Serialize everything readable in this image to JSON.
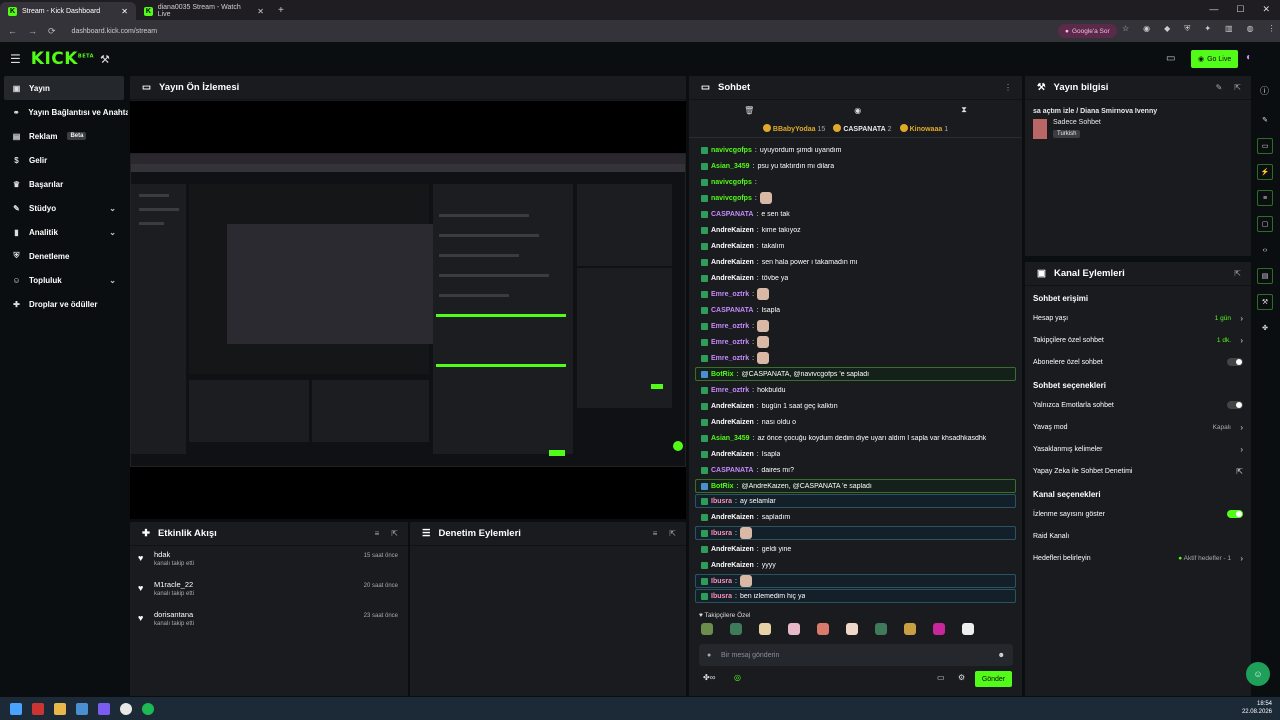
{
  "browser": {
    "tabs": [
      {
        "label": "Stream - Kick Dashboard",
        "active": true
      },
      {
        "label": "diana0035 Stream - Watch Live",
        "active": false
      }
    ],
    "url": "dashboard.kick.com/stream",
    "google_pill": "Google'a Sor"
  },
  "topbar": {
    "logo": "KICK",
    "logo_sup": "BETA",
    "go_live": "Go Live"
  },
  "sidebar": {
    "items": [
      {
        "label": "Yayın",
        "icon": "stream-icon",
        "active": true
      },
      {
        "label": "Yayın Bağlantısı ve Anahtarı",
        "icon": "link-icon"
      },
      {
        "label": "Reklam",
        "icon": "ad-icon",
        "badge": "Beta"
      },
      {
        "label": "Gelir",
        "icon": "dollar-icon"
      },
      {
        "label": "Başarılar",
        "icon": "trophy-icon"
      },
      {
        "label": "Stüdyo",
        "icon": "studio-icon",
        "chevron": true
      },
      {
        "label": "Analitik",
        "icon": "chart-icon",
        "chevron": true
      },
      {
        "label": "Denetleme",
        "icon": "shield-icon"
      },
      {
        "label": "Topluluk",
        "icon": "community-icon",
        "chevron": true
      },
      {
        "label": "Droplar ve ödüller",
        "icon": "gift-icon"
      }
    ]
  },
  "preview": {
    "title": "Yayın Ön İzlemesi"
  },
  "activity": {
    "title": "Etkinlik Akışı",
    "items": [
      {
        "name": "hdak",
        "action": "kanalı takip etti",
        "time": "15 saat önce"
      },
      {
        "name": "M1racle_22",
        "action": "kanalı takip etti",
        "time": "20 saat önce"
      },
      {
        "name": "dorisantana",
        "action": "kanalı takip etti",
        "time": "23 saat önce"
      }
    ]
  },
  "moderation": {
    "title": "Denetim Eylemleri"
  },
  "chat": {
    "title": "Sohbet",
    "top": [
      {
        "name": "BBabyYodaa",
        "count": "15",
        "color": "#e0a92a"
      },
      {
        "name": "CASPANATA",
        "count": "2",
        "color": "#ffffff"
      },
      {
        "name": "Kinowaaa",
        "count": "1",
        "color": "#e0a92a"
      }
    ],
    "messages": [
      {
        "user": "navivcgofps",
        "text": "uyuyordum şimdi uyandım",
        "color": "#53fc18",
        "type": ""
      },
      {
        "user": "Asian_3459",
        "text": "psu yu taktırdın mı dilara",
        "color": "#53fc18",
        "type": ""
      },
      {
        "user": "navivcgofps",
        "text": "",
        "color": "#53fc18",
        "type": ""
      },
      {
        "user": "navivcgofps",
        "text": "",
        "color": "#53fc18",
        "type": "emote"
      },
      {
        "user": "CASPANATA",
        "text": "e sen tak",
        "color": "#c58bff",
        "type": ""
      },
      {
        "user": "AndreKaizen",
        "text": "kime takıyoz",
        "color": "#ffffff",
        "type": ""
      },
      {
        "user": "AndreKaizen",
        "text": "takalım",
        "color": "#ffffff",
        "type": ""
      },
      {
        "user": "AndreKaizen",
        "text": "sen hala power ı takamadın mı",
        "color": "#ffffff",
        "type": ""
      },
      {
        "user": "AndreKaizen",
        "text": "tövbe ya",
        "color": "#ffffff",
        "type": ""
      },
      {
        "user": "Emre_oztrk",
        "text": "",
        "color": "#c58bff",
        "type": "emote"
      },
      {
        "user": "CASPANATA",
        "text": "İsapla",
        "color": "#c58bff",
        "type": ""
      },
      {
        "user": "Emre_oztrk",
        "text": "",
        "color": "#c58bff",
        "type": "emote"
      },
      {
        "user": "Emre_oztrk",
        "text": "",
        "color": "#c58bff",
        "type": "emote"
      },
      {
        "user": "Emre_oztrk",
        "text": "",
        "color": "#c58bff",
        "type": "emote"
      },
      {
        "user": "BotRix",
        "text": "@CASPANATA, @navivcgofps 'e sapladı",
        "color": "#53fc18",
        "type": "bot"
      },
      {
        "user": "Emre_oztrk",
        "text": "hokbuldu",
        "color": "#c58bff",
        "type": ""
      },
      {
        "user": "AndreKaizen",
        "text": "bugün 1 saat geç kalktın",
        "color": "#ffffff",
        "type": ""
      },
      {
        "user": "AndreKaizen",
        "text": "nası oldu o",
        "color": "#ffffff",
        "type": ""
      },
      {
        "user": "Asian_3459",
        "text": "az önce çocuğu koydum dedim diye uyarı aldım I sapla var khsadhkasdhk",
        "color": "#53fc18",
        "type": ""
      },
      {
        "user": "AndreKaizen",
        "text": "İsapla",
        "color": "#ffffff",
        "type": ""
      },
      {
        "user": "CASPANATA",
        "text": "daires mı?",
        "color": "#c58bff",
        "type": ""
      },
      {
        "user": "BotRix",
        "text": "@AndreKaizen, @CASPANATA 'e sapladı",
        "color": "#53fc18",
        "type": "bot"
      },
      {
        "user": "Ibusra",
        "text": "ay selamlar",
        "color": "#ff8fb3",
        "type": "hl"
      },
      {
        "user": "AndreKaizen",
        "text": "sapladım",
        "color": "#ffffff",
        "type": ""
      },
      {
        "user": "Ibusra",
        "text": "",
        "color": "#ff8fb3",
        "type": "hl-emote"
      },
      {
        "user": "AndreKaizen",
        "text": "geldi yine",
        "color": "#ffffff",
        "type": ""
      },
      {
        "user": "AndreKaizen",
        "text": "yyyy",
        "color": "#ffffff",
        "type": ""
      },
      {
        "user": "Ibusra",
        "text": "",
        "color": "#ff8fb3",
        "type": "hl-emote"
      },
      {
        "user": "Ibusra",
        "text": "ben izlemedim hiç ya",
        "color": "#ff8fb3",
        "type": "hl"
      }
    ],
    "followers_only_label": "Takipçilere Özel",
    "placeholder": "Bir mesaj gönderin",
    "send": "Gönder"
  },
  "stream_info": {
    "title": "Yayın bilgisi",
    "stream_title": "sa açtım izle / Diana Smirnova Ivenny",
    "category": "Sadece Sohbet",
    "language": "Turkish"
  },
  "channel_actions": {
    "title": "Kanal Eylemleri",
    "access_title": "Sohbet erişimi",
    "account_age": "Hesap yaşı",
    "account_age_val": "1 gün",
    "followers_chat": "Takipçilere özel sohbet",
    "followers_chat_val": "1 dk.",
    "subs_chat": "Abonelere özel sohbet",
    "options_title": "Sohbet seçenekleri",
    "emote_only": "Yalnızca Emotlarla sohbet",
    "slow_mode": "Yavaş mod",
    "slow_mode_val": "Kapalı",
    "banned_words": "Yasaklanmış kelimeler",
    "ai_moderation": "Yapay Zeka ile Sohbet Denetimi",
    "channel_opts_title": "Kanal seçenekleri",
    "show_viewers": "İzlenme sayısını göster",
    "raid": "Raid Kanalı",
    "goals": "Hedefleri belirleyin",
    "goals_val": "Aktif hedefler - 1"
  },
  "taskbar": {
    "time": "18:54",
    "date": "22.08.2026"
  },
  "colors": {
    "accent": "#53fc18",
    "bg": "#0b0e10",
    "panel": "#191b1f"
  }
}
